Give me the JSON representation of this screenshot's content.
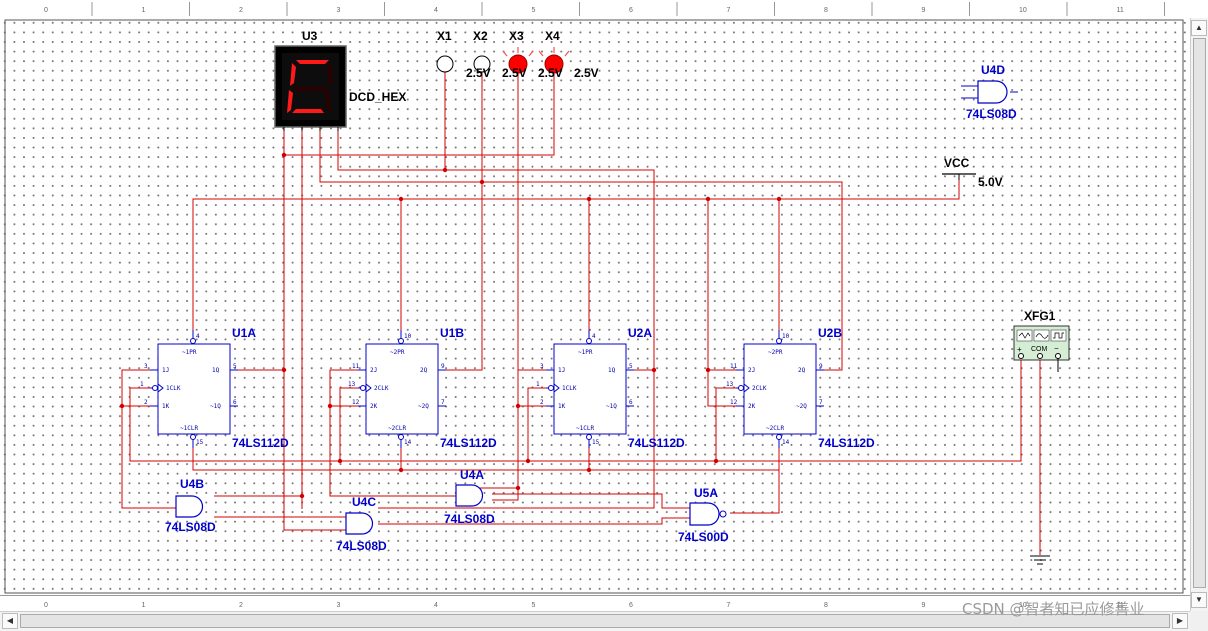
{
  "ruler": {
    "ticks": [
      "0",
      "1",
      "2",
      "3",
      "4",
      "5",
      "6",
      "7",
      "8",
      "9",
      "10",
      "11"
    ]
  },
  "display": {
    "ref": "U3",
    "model": "DCD_HEX",
    "digit": "C"
  },
  "probes": [
    {
      "ref": "X1",
      "voltage": "",
      "lit": false
    },
    {
      "ref": "X2",
      "voltage": "2.5V",
      "lit": false
    },
    {
      "ref": "X3",
      "voltage": "2.5V",
      "lit": true
    },
    {
      "ref": "X4",
      "voltage": "2.5V",
      "lit": true
    }
  ],
  "supply": {
    "ref": "VCC",
    "voltage": "5.0V"
  },
  "flip_flops": [
    {
      "ref": "U1A",
      "model": "74LS112D",
      "pre": "~1PR",
      "j": "1J",
      "clk": "1CLK",
      "k": "1K",
      "q": "1Q",
      "qn": "~1Q",
      "clr": "~1CLR",
      "pins": [
        "4",
        "3",
        "1",
        "2",
        "5",
        "6",
        "15"
      ]
    },
    {
      "ref": "U1B",
      "model": "74LS112D",
      "pre": "~2PR",
      "j": "2J",
      "clk": "2CLK",
      "k": "2K",
      "q": "2Q",
      "qn": "~2Q",
      "clr": "~2CLR",
      "pins": [
        "10",
        "11",
        "13",
        "12",
        "9",
        "7",
        "14"
      ]
    },
    {
      "ref": "U2A",
      "model": "74LS112D",
      "pre": "~1PR",
      "j": "1J",
      "clk": "1CLK",
      "k": "1K",
      "q": "1Q",
      "qn": "~1Q",
      "clr": "~1CLR",
      "pins": [
        "4",
        "3",
        "1",
        "2",
        "5",
        "6",
        "15"
      ]
    },
    {
      "ref": "U2B",
      "model": "74LS112D",
      "pre": "~2PR",
      "j": "2J",
      "clk": "2CLK",
      "k": "2K",
      "q": "2Q",
      "qn": "~2Q",
      "clr": "~2CLR",
      "pins": [
        "10",
        "11",
        "13",
        "12",
        "9",
        "7",
        "14"
      ]
    }
  ],
  "gates": [
    {
      "ref": "U4D",
      "model": "74LS08D",
      "type": "and"
    },
    {
      "ref": "U4B",
      "model": "74LS08D",
      "type": "and"
    },
    {
      "ref": "U4A",
      "model": "74LS08D",
      "type": "and"
    },
    {
      "ref": "U4C",
      "model": "74LS08D",
      "type": "and"
    },
    {
      "ref": "U5A",
      "model": "74LS00D",
      "type": "nand"
    }
  ],
  "generator": {
    "ref": "XFG1",
    "com_label": "COM",
    "plus": "+",
    "minus": "−"
  },
  "watermark": "CSDN @智者知已应修善业"
}
